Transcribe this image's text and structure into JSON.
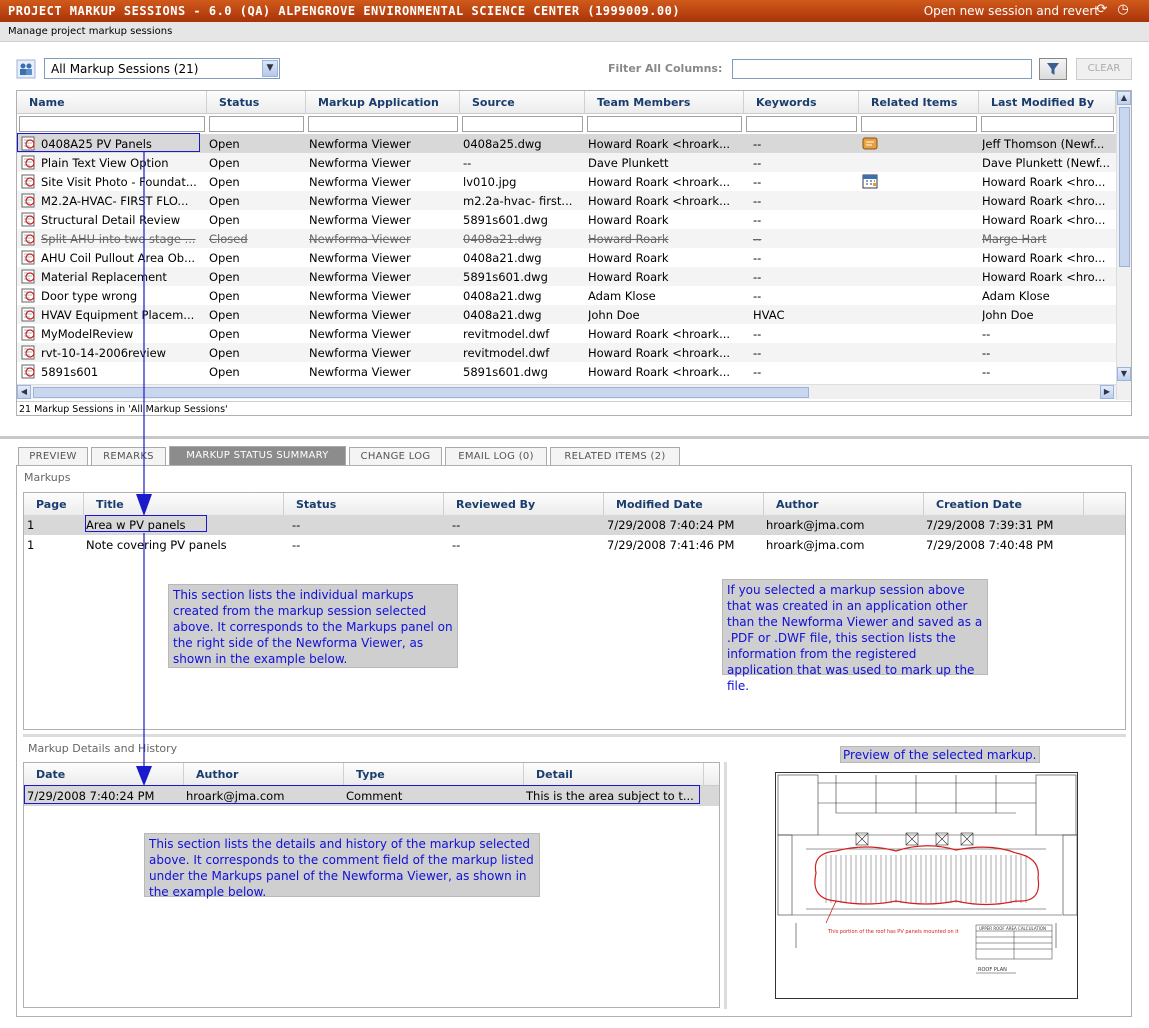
{
  "title_bar": {
    "title": "PROJECT MARKUP SESSIONS - 6.0 (QA) ALPENGROVE ENVIRONMENTAL SCIENCE CENTER (1999009.00)",
    "action_link": "Open new session and revert",
    "refresh_icon": "refresh-icon",
    "history_icon": "history-icon"
  },
  "subtitle": "Manage project markup sessions",
  "toolbar": {
    "view_select": "All Markup Sessions (21)",
    "filter_label": "Filter All Columns:",
    "filter_value": "",
    "clear_label": "CLEAR"
  },
  "sessions": {
    "columns": [
      "Name",
      "Status",
      "Markup Application",
      "Source",
      "Team Members",
      "Keywords",
      "Related Items",
      "Last Modified By"
    ],
    "rows": [
      {
        "name": "0408A25 PV Panels",
        "status": "Open",
        "app": "Newforma Viewer",
        "source": "0408a25.dwg",
        "team": "Howard Roark <hroark...",
        "keywords": "--",
        "related": "note",
        "modified_by": "Jeff Thomson (Newf..."
      },
      {
        "name": "Plain Text View Option",
        "status": "Open",
        "app": "Newforma Viewer",
        "source": "--",
        "team": "Dave Plunkett",
        "keywords": "--",
        "related": "",
        "modified_by": "Dave Plunkett (Newf..."
      },
      {
        "name": "Site Visit Photo - Foundat...",
        "status": "Open",
        "app": "Newforma Viewer",
        "source": "lv010.jpg",
        "team": "Howard Roark <hroark...",
        "keywords": "--",
        "related": "calendar",
        "modified_by": "Howard Roark <hro..."
      },
      {
        "name": "M2.2A-HVAC- FIRST FLO...",
        "status": "Open",
        "app": "Newforma Viewer",
        "source": "m2.2a-hvac- first...",
        "team": "Howard Roark <hroark...",
        "keywords": "--",
        "related": "",
        "modified_by": "Howard Roark <hro..."
      },
      {
        "name": "Structural Detail Review",
        "status": "Open",
        "app": "Newforma Viewer",
        "source": "5891s601.dwg",
        "team": "Howard Roark",
        "keywords": "--",
        "related": "",
        "modified_by": "Howard Roark <hro..."
      },
      {
        "name": "Split AHU into two stage ...",
        "status": "Closed",
        "app": "Newforma Viewer",
        "source": "0408a21.dwg",
        "team": "Howard Roark",
        "keywords": "--",
        "related": "",
        "modified_by": "Marge Hart"
      },
      {
        "name": "AHU Coil Pullout Area Ob...",
        "status": "Open",
        "app": "Newforma Viewer",
        "source": "0408a21.dwg",
        "team": "Howard Roark",
        "keywords": "--",
        "related": "",
        "modified_by": "Howard Roark <hro..."
      },
      {
        "name": "Material Replacement",
        "status": "Open",
        "app": "Newforma Viewer",
        "source": "5891s601.dwg",
        "team": "Howard Roark",
        "keywords": "--",
        "related": "",
        "modified_by": "Howard Roark <hro..."
      },
      {
        "name": "Door type wrong",
        "status": "Open",
        "app": "Newforma Viewer",
        "source": "0408a21.dwg",
        "team": "Adam Klose",
        "keywords": "--",
        "related": "",
        "modified_by": "Adam Klose"
      },
      {
        "name": "HVAV Equipment Placem...",
        "status": "Open",
        "app": "Newforma Viewer",
        "source": "0408a21.dwg",
        "team": "John Doe",
        "keywords": "HVAC",
        "related": "",
        "modified_by": "John Doe"
      },
      {
        "name": "MyModelReview",
        "status": "Open",
        "app": "Newforma Viewer",
        "source": "revitmodel.dwf",
        "team": "Howard Roark <hroark...",
        "keywords": "--",
        "related": "",
        "modified_by": "--"
      },
      {
        "name": "rvt-10-14-2006review",
        "status": "Open",
        "app": "Newforma Viewer",
        "source": "revitmodel.dwf",
        "team": "Howard Roark <hroark...",
        "keywords": "--",
        "related": "",
        "modified_by": "--"
      },
      {
        "name": "5891s601",
        "status": "Open",
        "app": "Newforma Viewer",
        "source": "5891s601.dwg",
        "team": "Howard Roark <hroark...",
        "keywords": "--",
        "related": "",
        "modified_by": "--"
      }
    ],
    "status_text": "21 Markup Sessions in 'All Markup Sessions'"
  },
  "tabs": [
    "PREVIEW",
    "REMARKS",
    "MARKUP STATUS SUMMARY",
    "CHANGE LOG",
    "EMAIL LOG (0)",
    "RELATED ITEMS (2)"
  ],
  "markups": {
    "label": "Markups",
    "columns": [
      "Page",
      "Title",
      "Status",
      "Reviewed By",
      "Modified Date",
      "Author",
      "Creation Date"
    ],
    "rows": [
      {
        "page": "1",
        "title": "Area w PV panels",
        "status": "--",
        "reviewed_by": "--",
        "modified": "7/29/2008 7:40:24 PM",
        "author": "hroark@jma.com",
        "created": "7/29/2008 7:39:31 PM"
      },
      {
        "page": "1",
        "title": "Note covering PV panels",
        "status": "--",
        "reviewed_by": "--",
        "modified": "7/29/2008 7:41:46 PM",
        "author": "hroark@jma.com",
        "created": "7/29/2008 7:40:48 PM"
      }
    ]
  },
  "details": {
    "label": "Markup Details and History",
    "columns": [
      "Date",
      "Author",
      "Type",
      "Detail"
    ],
    "rows": [
      {
        "date": "7/29/2008 7:40:24 PM",
        "author": "hroark@jma.com",
        "type": "Comment",
        "detail": "This is the area subject to t..."
      }
    ]
  },
  "callouts": {
    "markups": "This section lists the individual markups created from the markup session selected above. It corresponds to the Markups panel on the right side of the Newforma Viewer, as shown in the example below.",
    "registered": "If you selected a markup session above that was created in an application other than the Newforma Viewer and saved as a .PDF or .DWF file, this section lists the information from the registered application that was used to mark up the file.",
    "details": "This section lists the details and history of the markup selected above. It corresponds to the comment field of the markup listed under the Markups panel of the Newforma Viewer, as shown in the example below.",
    "preview": "Preview of the selected markup."
  },
  "preview_drawing": {
    "note": "This portion of the roof has PV panels mounted on it",
    "calc_title": "UPPER ROOF AREA CALCULATION",
    "plan_label": "ROOF PLAN"
  },
  "colors": {
    "title_bar": "#b8400f",
    "callout_text": "#1010d8",
    "arrow": "#1a1acc",
    "markup_cloud": "#d02020"
  }
}
